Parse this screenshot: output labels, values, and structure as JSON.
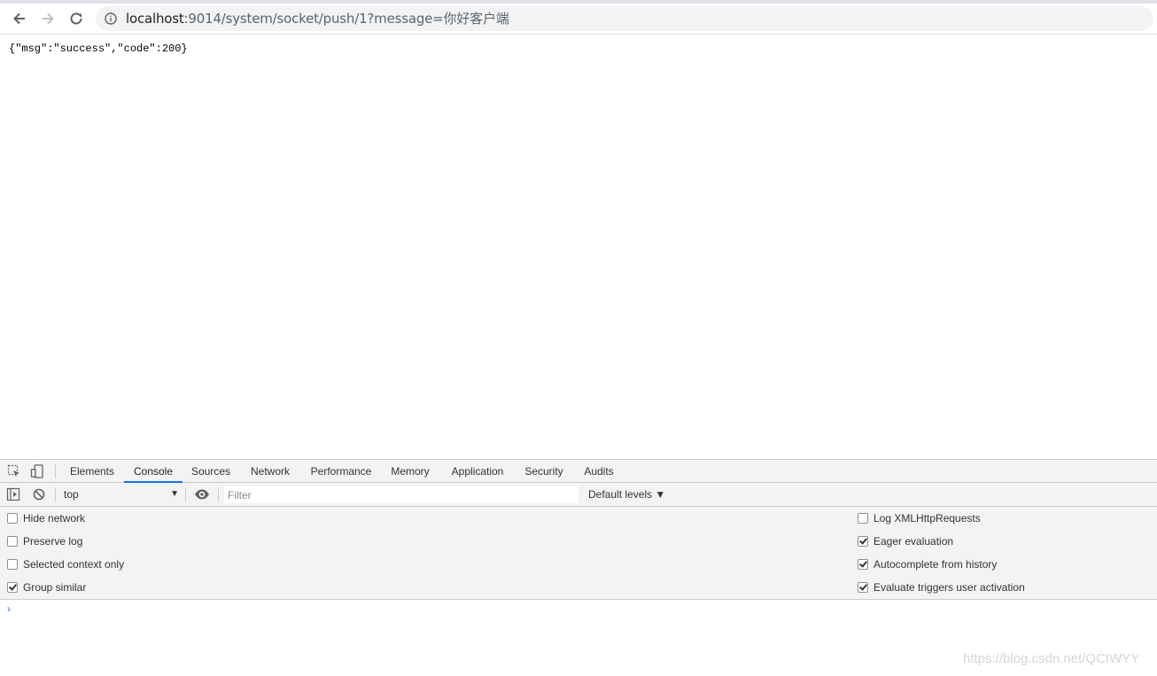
{
  "browser": {
    "url_host": "localhost",
    "url_rest": ":9014/system/socket/push/1?message=你好客户端"
  },
  "page": {
    "content": "{\"msg\":\"success\",\"code\":200}"
  },
  "devtools": {
    "tabs": [
      "Elements",
      "Console",
      "Sources",
      "Network",
      "Performance",
      "Memory",
      "Application",
      "Security",
      "Audits"
    ],
    "active_tab": "Console",
    "context": "top",
    "filter_placeholder": "Filter",
    "levels_label": "Default levels ▼",
    "settings_left": [
      {
        "label": "Hide network",
        "checked": false
      },
      {
        "label": "Preserve log",
        "checked": false
      },
      {
        "label": "Selected context only",
        "checked": false
      },
      {
        "label": "Group similar",
        "checked": true
      }
    ],
    "settings_right": [
      {
        "label": "Log XMLHttpRequests",
        "checked": false
      },
      {
        "label": "Eager evaluation",
        "checked": true
      },
      {
        "label": "Autocomplete from history",
        "checked": true
      },
      {
        "label": "Evaluate triggers user activation",
        "checked": true
      }
    ],
    "prompt_symbol": "›"
  },
  "watermark": "https://blog.csdn.net/QCIWYY",
  "colors": {
    "accent": "#1a73e8",
    "toolbar_bg": "#f3f3f3"
  }
}
